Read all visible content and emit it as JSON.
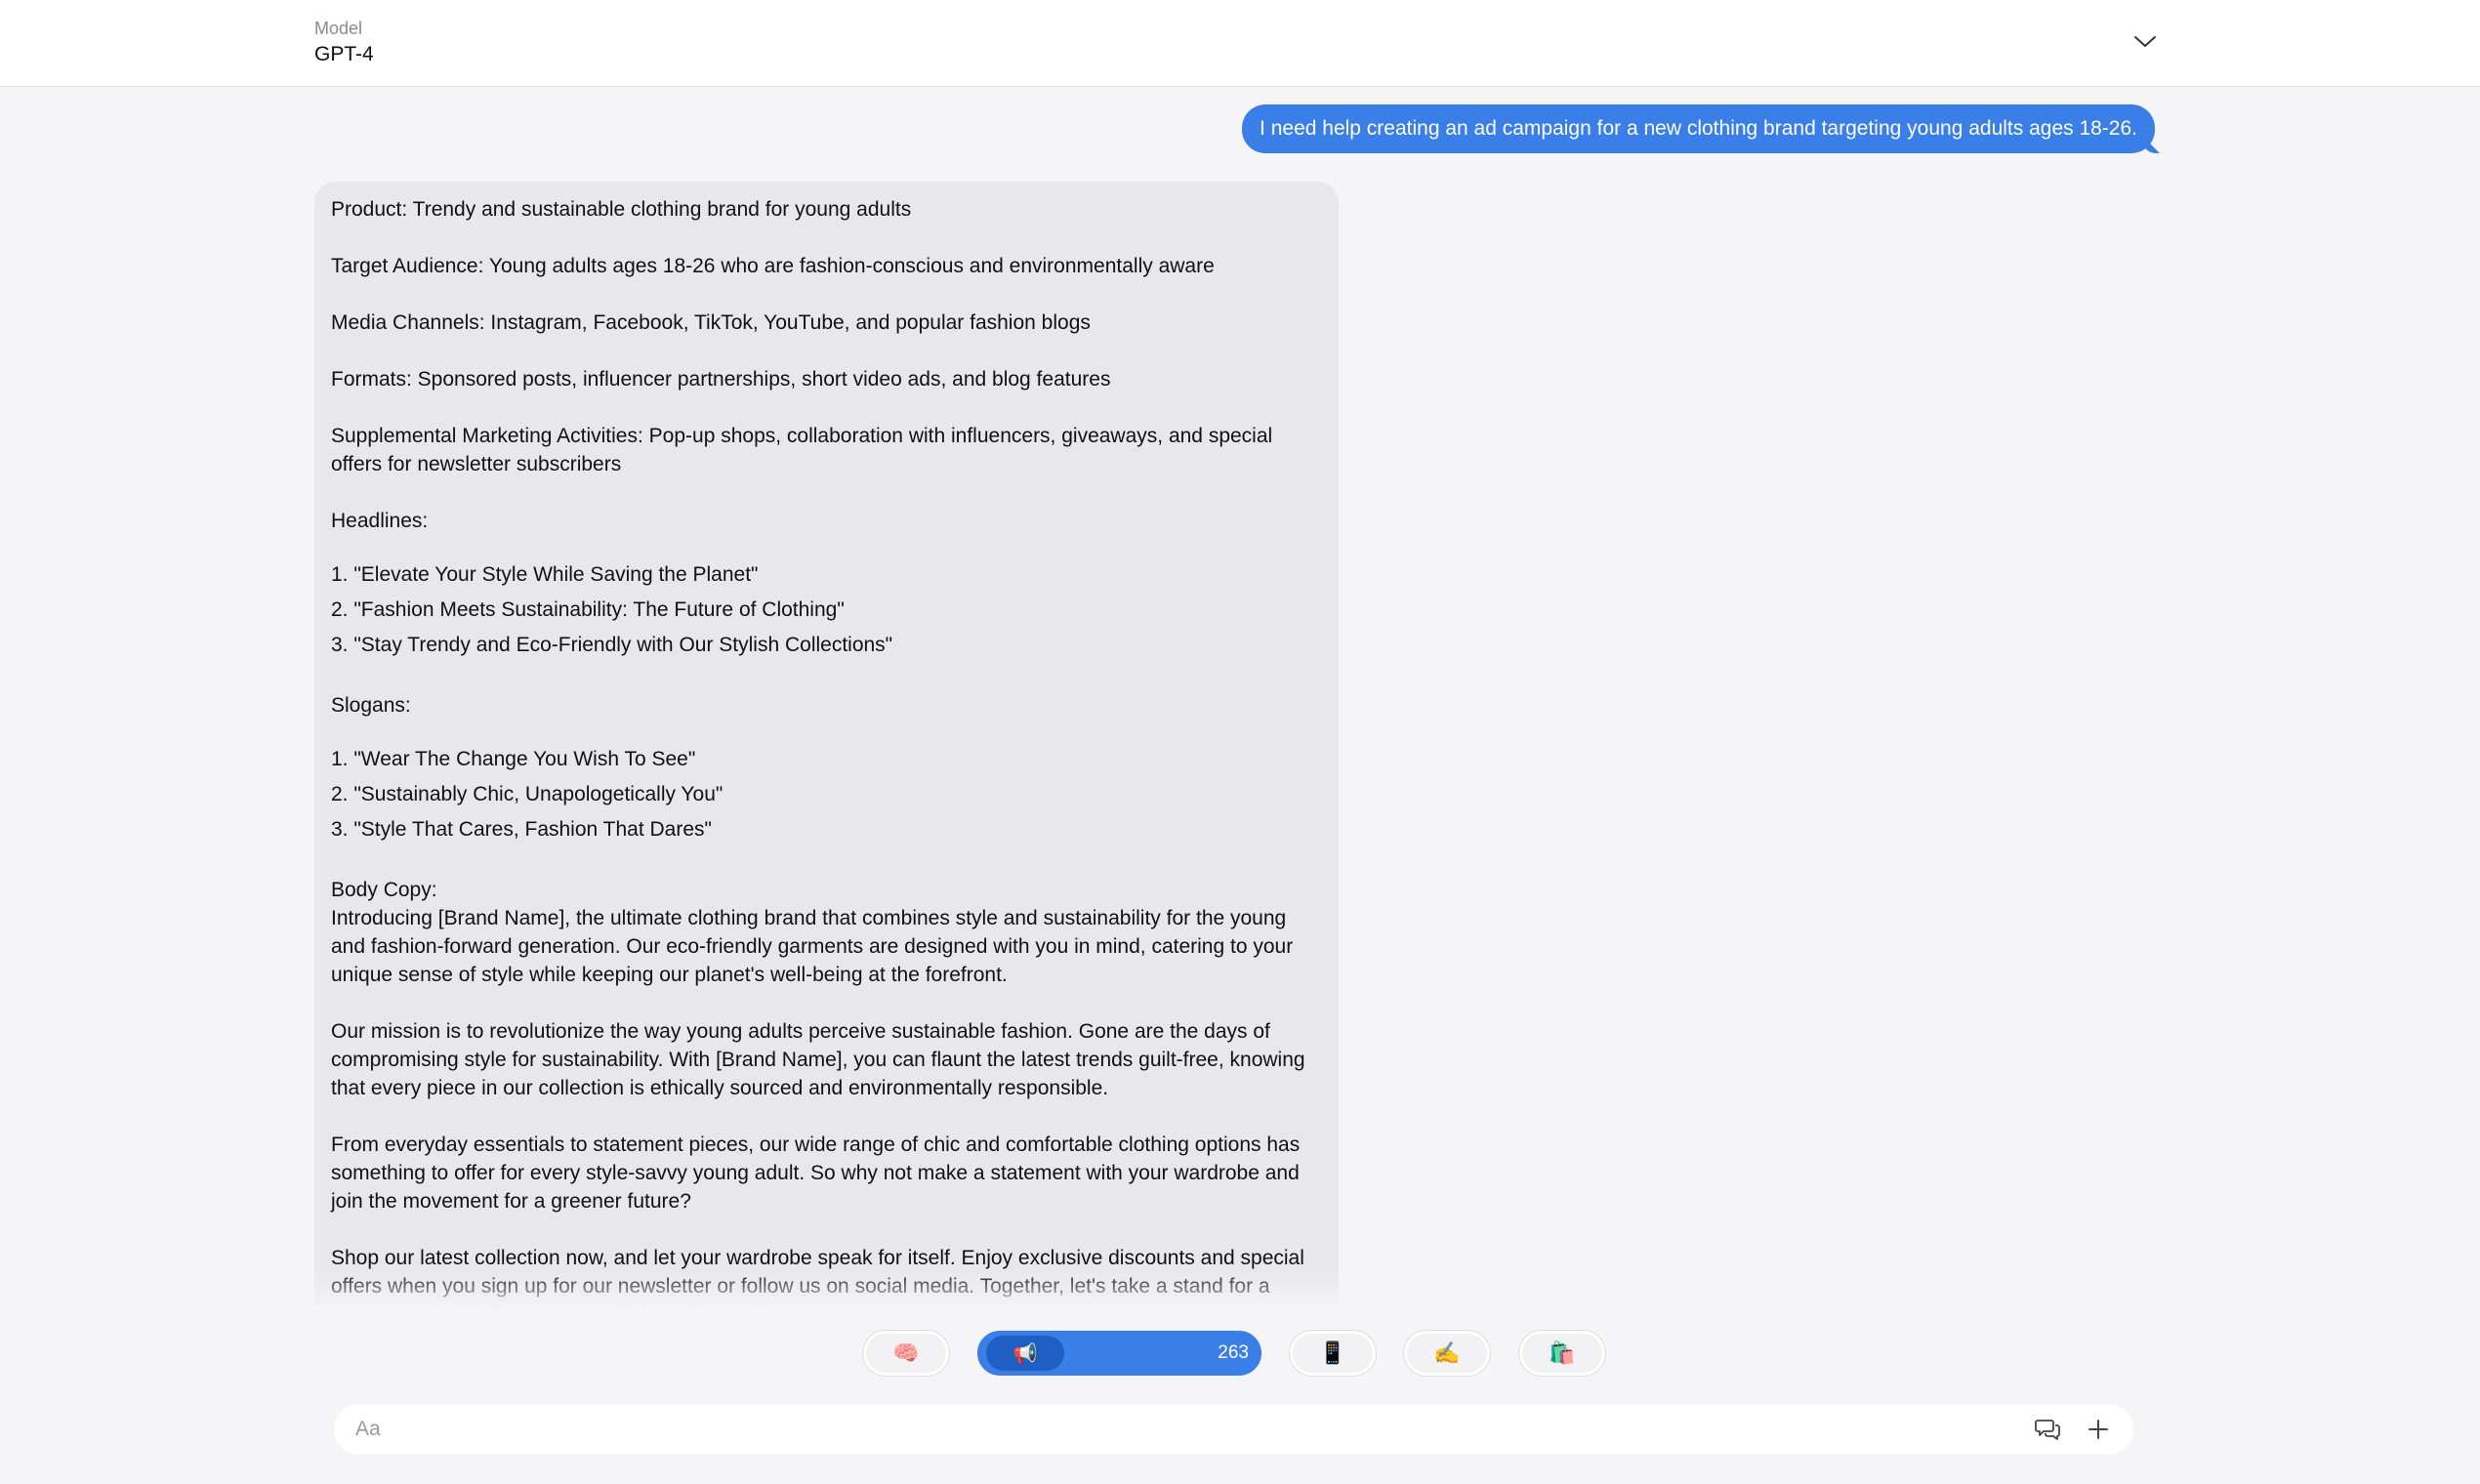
{
  "header": {
    "model_label": "Model",
    "model_value": "GPT-4"
  },
  "user_message": "I need help creating an ad campaign for a new clothing brand targeting young adults ages 18-26.",
  "assistant": {
    "product": "Product: Trendy and sustainable clothing brand for young adults",
    "audience": "Target Audience: Young adults ages 18-26 who are fashion-conscious and environmentally aware",
    "channels": "Media Channels: Instagram, Facebook, TikTok, YouTube, and popular fashion blogs",
    "formats": "Formats: Sponsored posts, influencer partnerships, short video ads, and blog features",
    "supplemental": "Supplemental Marketing Activities: Pop-up shops, collaboration with influencers, giveaways, and special offers for newsletter subscribers",
    "headlines_title": "Headlines:",
    "headlines": [
      "1.  \"Elevate Your Style While Saving the Planet\"",
      "2.  \"Fashion Meets Sustainability: The Future of Clothing\"",
      "3.  \"Stay Trendy and Eco-Friendly with Our Stylish Collections\""
    ],
    "slogans_title": "Slogans:",
    "slogans": [
      "1.  \"Wear The Change You Wish To See\"",
      "2.  \"Sustainably Chic, Unapologetically You\"",
      "3.  \"Style That Cares, Fashion That Dares\""
    ],
    "body_title": "Body Copy:",
    "body_1": "Introducing [Brand Name], the ultimate clothing brand that combines style and sustainability for the young and fashion-forward generation. Our eco-friendly garments are designed with you in mind, catering to your unique sense of style while keeping our planet's well-being at the forefront.",
    "body_2": "Our mission is to revolutionize the way young adults perceive sustainable fashion. Gone are the days of compromising style for sustainability. With [Brand Name], you can flaunt the latest trends guilt-free, knowing that every piece in our collection is ethically sourced and environmentally responsible.",
    "body_3": "From everyday essentials to statement pieces, our wide range of chic and comfortable clothing options has something to offer for every style-savvy young adult. So why not make a statement with your wardrobe and join the movement for a greener future?",
    "body_4": "Shop our latest collection now, and let your wardrobe speak for itself. Enjoy exclusive discounts and special offers when you sign up for our newsletter or follow us on social media. Together, let's take a stand for a more sustainable future, one stylish outfit at a time."
  },
  "chips": [
    {
      "icon": "🧠",
      "name": "brain"
    },
    {
      "icon": "📢",
      "name": "megaphone",
      "count": "263",
      "active": true
    },
    {
      "icon": "📱",
      "name": "phone"
    },
    {
      "icon": "✍️",
      "name": "writing-hand"
    },
    {
      "icon": "🛍️",
      "name": "shopping-bags"
    }
  ],
  "input": {
    "placeholder": "Aa"
  },
  "colors": {
    "accent": "#3a7ee8",
    "accent_dark": "#1f5fc4",
    "assistant_bg": "#e8e8ec",
    "page_bg": "#f5f5f7"
  }
}
